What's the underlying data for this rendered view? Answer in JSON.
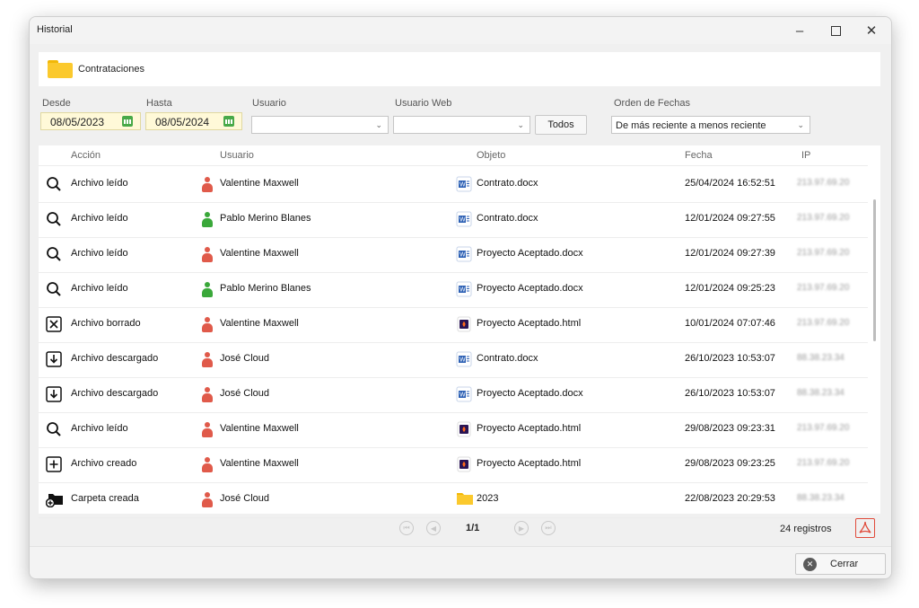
{
  "window": {
    "title": "Historial"
  },
  "header": {
    "folder_name": "Contrataciones"
  },
  "filters": {
    "desde_label": "Desde",
    "desde_value": "08/05/2023",
    "hasta_label": "Hasta",
    "hasta_value": "08/05/2024",
    "usuario_label": "Usuario",
    "usuario_value": "",
    "usuario_web_label": "Usuario Web",
    "usuario_web_value": "",
    "todos_label": "Todos",
    "orden_label": "Orden de Fechas",
    "orden_value": "De más reciente a menos reciente"
  },
  "table": {
    "headers": {
      "accion": "Acción",
      "usuario": "Usuario",
      "objeto": "Objeto",
      "fecha": "Fecha",
      "ip": "IP"
    },
    "rows": [
      {
        "accion": "Archivo leído",
        "accion_icon": "search-icon",
        "usuario": "Valentine Maxwell",
        "user_color": "#e05a4a",
        "objeto": "Contrato.docx",
        "file_icon": "word-doc-icon",
        "fecha": "25/04/2024 16:52:51",
        "ip": "213.97.69.20"
      },
      {
        "accion": "Archivo leído",
        "accion_icon": "search-icon",
        "usuario": "Pablo Merino Blanes",
        "user_color": "#3aa83a",
        "objeto": "Contrato.docx",
        "file_icon": "word-doc-icon",
        "fecha": "12/01/2024 09:27:55",
        "ip": "213.97.69.20"
      },
      {
        "accion": "Archivo leído",
        "accion_icon": "search-icon",
        "usuario": "Valentine Maxwell",
        "user_color": "#e05a4a",
        "objeto": "Proyecto Aceptado.docx",
        "file_icon": "word-doc-icon",
        "fecha": "12/01/2024 09:27:39",
        "ip": "213.97.69.20"
      },
      {
        "accion": "Archivo leído",
        "accion_icon": "search-icon",
        "usuario": "Pablo Merino Blanes",
        "user_color": "#3aa83a",
        "objeto": "Proyecto Aceptado.docx",
        "file_icon": "word-doc-icon",
        "fecha": "12/01/2024 09:25:23",
        "ip": "213.97.69.20"
      },
      {
        "accion": "Archivo borrado",
        "accion_icon": "delete-box-icon",
        "usuario": "Valentine Maxwell",
        "user_color": "#e05a4a",
        "objeto": "Proyecto Aceptado.html",
        "file_icon": "html-file-icon",
        "fecha": "10/01/2024 07:07:46",
        "ip": "213.97.69.20"
      },
      {
        "accion": "Archivo descargado",
        "accion_icon": "download-icon",
        "usuario": "José Cloud",
        "user_color": "#e05a4a",
        "objeto": "Contrato.docx",
        "file_icon": "word-doc-icon",
        "fecha": "26/10/2023 10:53:07",
        "ip": "88.38.23.34"
      },
      {
        "accion": "Archivo descargado",
        "accion_icon": "download-icon",
        "usuario": "José Cloud",
        "user_color": "#e05a4a",
        "objeto": "Proyecto Aceptado.docx",
        "file_icon": "word-doc-icon",
        "fecha": "26/10/2023 10:53:07",
        "ip": "88.38.23.34"
      },
      {
        "accion": "Archivo leído",
        "accion_icon": "search-icon",
        "usuario": "Valentine Maxwell",
        "user_color": "#e05a4a",
        "objeto": "Proyecto Aceptado.html",
        "file_icon": "html-file-icon",
        "fecha": "29/08/2023 09:23:31",
        "ip": "213.97.69.20"
      },
      {
        "accion": "Archivo creado",
        "accion_icon": "add-box-icon",
        "usuario": "Valentine Maxwell",
        "user_color": "#e05a4a",
        "objeto": "Proyecto Aceptado.html",
        "file_icon": "html-file-icon",
        "fecha": "29/08/2023 09:23:25",
        "ip": "213.97.69.20"
      },
      {
        "accion": "Carpeta creada",
        "accion_icon": "folder-add-icon",
        "usuario": "José Cloud",
        "user_color": "#e05a4a",
        "objeto": "2023",
        "file_icon": "folder-icon",
        "fecha": "22/08/2023 20:29:53",
        "ip": "88.38.23.34"
      }
    ]
  },
  "pager": {
    "page": "1/1",
    "records": "24 registros"
  },
  "footer": {
    "close_label": "Cerrar"
  }
}
